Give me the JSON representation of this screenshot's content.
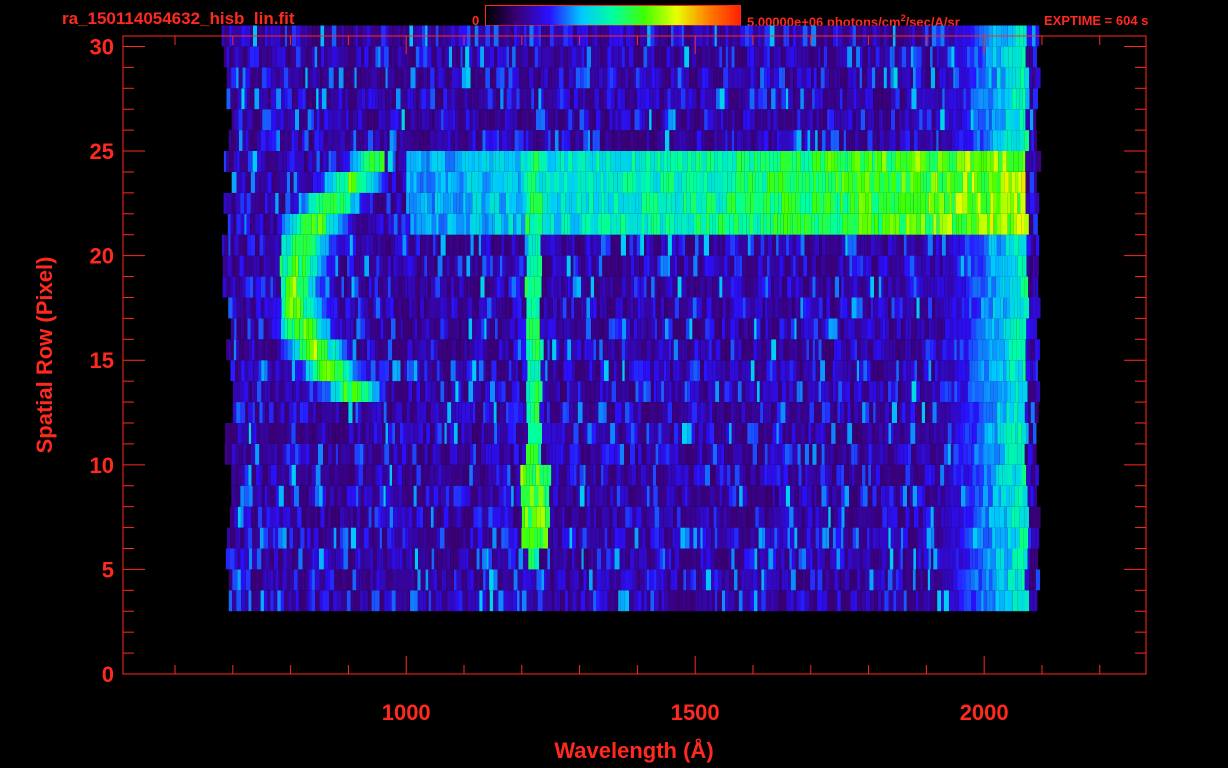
{
  "header": {
    "file_name": "ra_150114054632_hisb_lin.fit",
    "colorbar_min": "0",
    "colorbar_max": "5.00000e+06 photons/cm",
    "colorbar_max_sup": "2",
    "colorbar_max_rest": "/sec/A/sr",
    "exptime": "EXPTIME = 604 s"
  },
  "colors": {
    "axis": "#ff2a1f",
    "background": "#000000",
    "colormap": [
      "#000000",
      "#3a0078",
      "#2a10ff",
      "#00c8ff",
      "#00ffa0",
      "#40ff00",
      "#e8ff00",
      "#ff8000",
      "#ff2000"
    ]
  },
  "chart_data": {
    "type": "heatmap",
    "title": "",
    "xlabel": "Wavelength (Å)",
    "ylabel": "Spatial Row (Pixel)",
    "xlim": [
      510,
      2280
    ],
    "ylim": [
      0,
      30.5
    ],
    "x_ticks": [
      1000,
      1500,
      2000
    ],
    "y_ticks": [
      0,
      5,
      10,
      15,
      20,
      25,
      30
    ],
    "rows_range": [
      3,
      30
    ],
    "wavelength_range": [
      680,
      2090
    ],
    "colorbar_range": [
      0,
      5000000
    ],
    "features": [
      {
        "name": "curved arc",
        "rows": [
          13,
          24
        ],
        "wavelength": [
          780,
          960
        ],
        "peak_intensity": 0.7
      },
      {
        "name": "line 1216",
        "rows": [
          5,
          24
        ],
        "wavelength": [
          1205,
          1230
        ],
        "peak_intensity": 0.55
      },
      {
        "name": "band row 22",
        "rows": [
          21,
          24
        ],
        "wavelength": [
          1000,
          2070
        ],
        "peak_intensity": 0.72
      },
      {
        "name": "blob row 7",
        "rows": [
          6,
          9
        ],
        "wavelength": [
          1195,
          1245
        ],
        "peak_intensity": 0.65
      },
      {
        "name": "long wavelength continuum",
        "rows": [
          3,
          30
        ],
        "wavelength": [
          1850,
          2070
        ],
        "peak_intensity": 0.5
      }
    ]
  }
}
